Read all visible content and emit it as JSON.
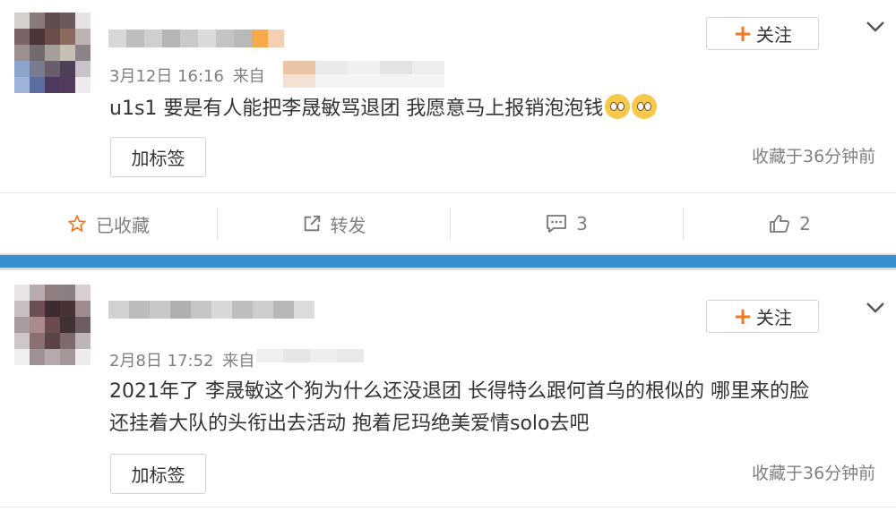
{
  "posts": [
    {
      "follow_label": "关注",
      "meta_time": "3月12日 16:16",
      "meta_from": "来自",
      "content_lines": [
        "u1s1 要是有人能把李晟敏骂退团 我愿意马上报销泡泡钱"
      ],
      "tag_label": "加标签",
      "fav_time": "收藏于36分钟前",
      "actions": {
        "favorite": "已收藏",
        "repost": "转发",
        "comment": "3",
        "like": "2"
      }
    },
    {
      "follow_label": "关注",
      "meta_time": "2月8日 17:52",
      "meta_from": "来自",
      "content_lines": [
        "2021年了 李晟敏这个狗为什么还没退团  长得特么跟何首乌的根似的 哪里来的脸",
        "还挂着大队的头衔出去活动 抱着尼玛绝美爱情solo去吧"
      ],
      "tag_label": "加标签",
      "fav_time": "收藏于36分钟前"
    }
  ],
  "colors": {
    "accent_orange": "#f37721",
    "text": "#333333",
    "muted": "#808080",
    "divider_blue": "#3a8fd0"
  },
  "icons": [
    "plus-icon",
    "chevron-down-icon",
    "star-icon",
    "repost-icon",
    "comment-icon",
    "like-icon",
    "emoji-icon"
  ]
}
